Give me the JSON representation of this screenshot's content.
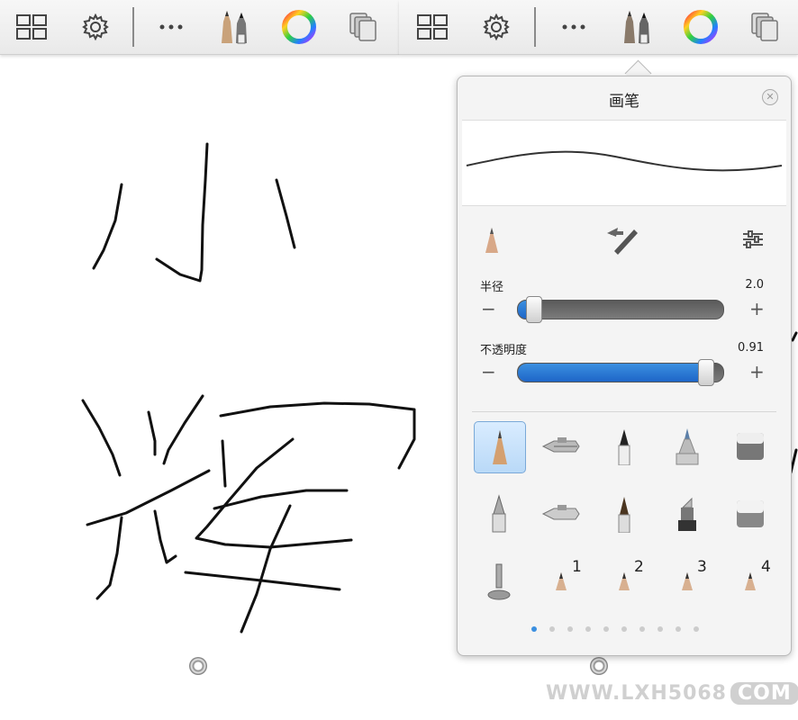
{
  "panel": {
    "title": "画笔",
    "sliders": [
      {
        "label": "半径",
        "value": "2.0",
        "fraction": 0.08
      },
      {
        "label": "不透明度",
        "value": "0.91",
        "fraction": 0.91
      }
    ],
    "minus_label": "−",
    "plus_label": "+"
  },
  "toolbar_icons": [
    "grid-icon",
    "gear-icon",
    "more-icon",
    "pencils-icon",
    "color-wheel-icon",
    "layers-icon"
  ],
  "brush_numbers": [
    "1",
    "2",
    "3",
    "4"
  ],
  "pagination": {
    "count": 10,
    "active": 0
  },
  "watermark": {
    "text": "WWW.LXH5068",
    "suffix": "COM"
  },
  "colors": {
    "accent": "#3b8fe0",
    "stroke": "#111111"
  }
}
